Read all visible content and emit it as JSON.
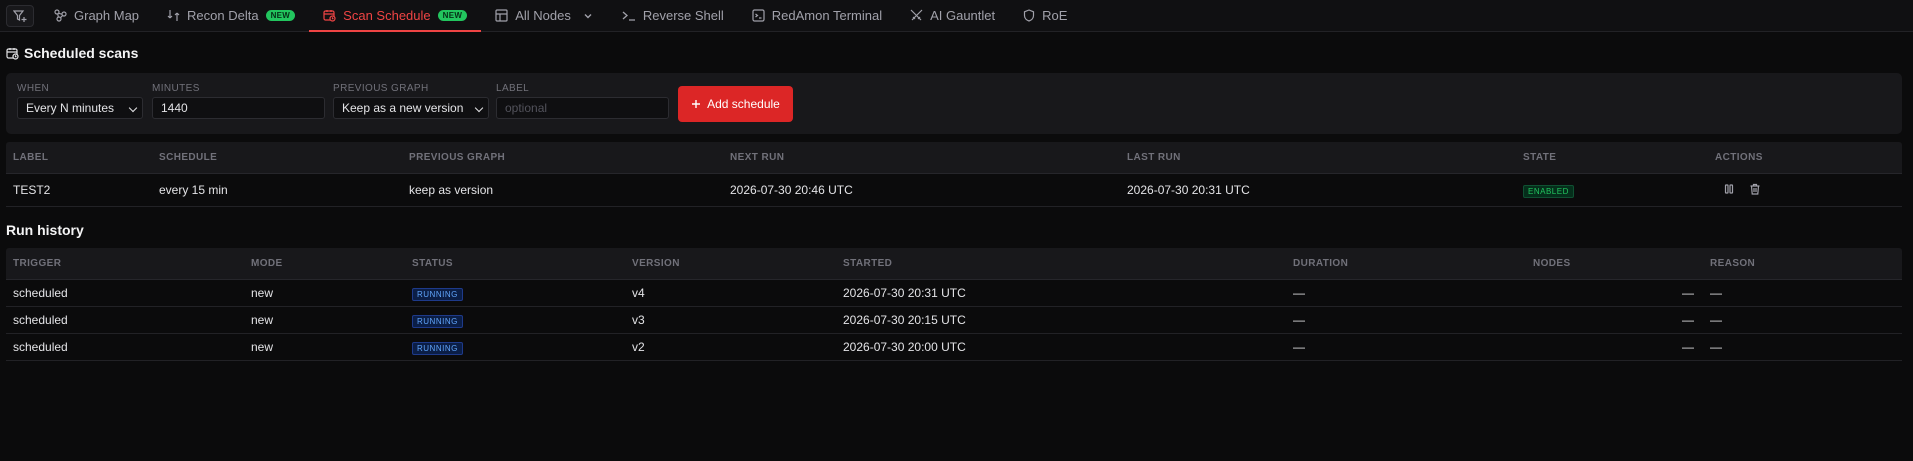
{
  "tabs": [
    {
      "label": "Graph Map",
      "icon": "graph-map-icon"
    },
    {
      "label": "Recon Delta",
      "icon": "recon-delta-icon",
      "badge": "NEW"
    },
    {
      "label": "Scan Schedule",
      "icon": "calendar-clock-icon",
      "badge": "NEW",
      "active": true
    },
    {
      "label": "All Nodes",
      "icon": "table-icon"
    },
    {
      "label": "Reverse Shell",
      "icon": "terminal-prompt-icon"
    },
    {
      "label": "RedAmon Terminal",
      "icon": "terminal-window-icon"
    },
    {
      "label": "AI Gauntlet",
      "icon": "crossed-swords-icon"
    },
    {
      "label": "RoE",
      "icon": "shield-icon"
    }
  ],
  "scheduled": {
    "title": "Scheduled scans",
    "form": {
      "when_label": "WHEN",
      "when_value": "Every N minutes",
      "minutes_label": "MINUTES",
      "minutes_value": "1440",
      "previous_graph_label": "PREVIOUS GRAPH",
      "previous_graph_value": "Keep as a new version",
      "label_label": "LABEL",
      "label_placeholder": "optional",
      "add_button": "Add schedule"
    },
    "columns": [
      "LABEL",
      "SCHEDULE",
      "PREVIOUS GRAPH",
      "NEXT RUN",
      "LAST RUN",
      "STATE",
      "ACTIONS"
    ],
    "rows": [
      {
        "label": "TEST2",
        "schedule": "every 15 min",
        "previous_graph": "keep as version",
        "next_run": "2026-07-30 20:46 UTC",
        "last_run": "2026-07-30 20:31 UTC",
        "state": "ENABLED"
      }
    ]
  },
  "history": {
    "title": "Run history",
    "columns": [
      "TRIGGER",
      "MODE",
      "STATUS",
      "VERSION",
      "STARTED",
      "DURATION",
      "NODES",
      "REASON"
    ],
    "rows": [
      {
        "trigger": "scheduled",
        "mode": "new",
        "status": "RUNNING",
        "version": "v4",
        "started": "2026-07-30 20:31 UTC",
        "duration": "—",
        "nodes": "—",
        "reason": "—"
      },
      {
        "trigger": "scheduled",
        "mode": "new",
        "status": "RUNNING",
        "version": "v3",
        "started": "2026-07-30 20:15 UTC",
        "duration": "—",
        "nodes": "—",
        "reason": "—"
      },
      {
        "trigger": "scheduled",
        "mode": "new",
        "status": "RUNNING",
        "version": "v2",
        "started": "2026-07-30 20:00 UTC",
        "duration": "—",
        "nodes": "—",
        "reason": "—"
      }
    ]
  },
  "colors": {
    "accent": "#ef4444",
    "button": "#dc2626",
    "new_badge": "#22c55e",
    "enabled": "#22c55e",
    "running": "#60a5fa"
  }
}
